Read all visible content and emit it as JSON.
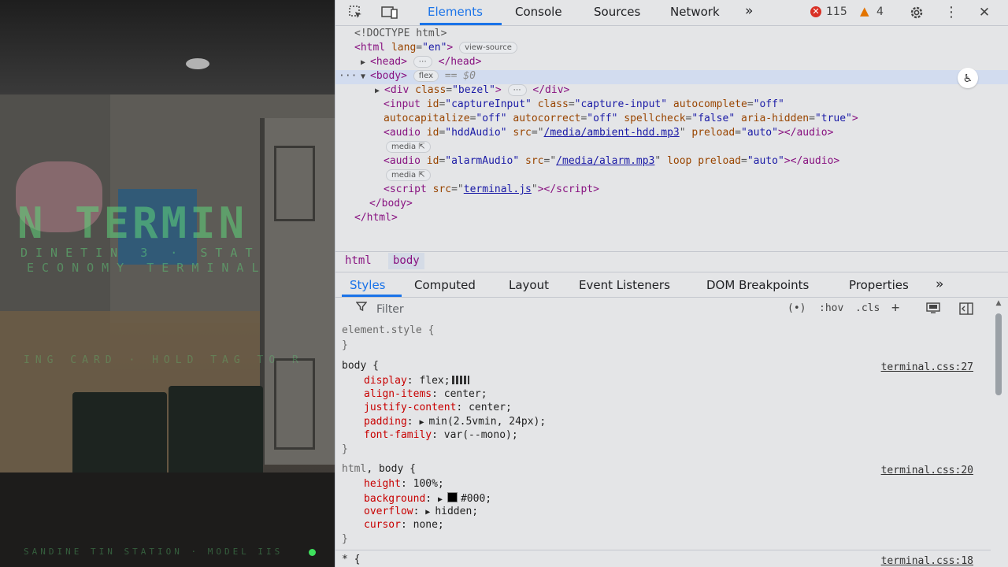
{
  "viewport": {
    "title": "N TERMIN",
    "subtitle1": "DINETIN 3 · STAT",
    "subtitle2": "ECONOMY TERMINAL",
    "hint": "ING CARD · HOLD TAG TO R",
    "footer": "SANDINE TIN STATION · MODEL IIS",
    "accent": "#5fd67b"
  },
  "devtools": {
    "toolbar": {
      "inspect_icon": "inspect-icon",
      "device_icon": "device-toolbar-icon",
      "tabs": [
        "Elements",
        "Console",
        "Sources",
        "Network"
      ],
      "more_tabs": "»",
      "errors": "115",
      "warnings": "4",
      "settings_icon": "gear-icon",
      "menu_icon": "kebab-icon",
      "close": "✕"
    },
    "dom": {
      "doctype": "<!DOCTYPE html>",
      "html_open": "<html",
      "html_attr": "lang",
      "html_val": "\"en\"",
      "view_source": "view-source",
      "head_open": "<head>",
      "ellipsis": "⋯",
      "head_close": "</head>",
      "row_dots": "···",
      "body_open": "<body>",
      "flex_chip": "flex",
      "eq_ref": "== $0",
      "div_open": "<div",
      "div_attr": "class",
      "div_val": "\"bezel\"",
      "div_close": "</div>",
      "input_open": "<input",
      "input_attrs1": [
        [
          "id",
          "\"captureInput\""
        ],
        [
          "class",
          "\"capture-input\""
        ],
        [
          "autocomplete",
          "\"off\""
        ]
      ],
      "input_attrs2": [
        [
          "autocapitalize",
          "\"off\""
        ],
        [
          "autocorrect",
          "\"off\""
        ],
        [
          "spellcheck",
          "\"false\""
        ],
        [
          "aria-hidden",
          "\"true\""
        ]
      ],
      "audio1_id": "\"hddAudio\"",
      "audio1_src": "/media/ambient-hdd.mp3",
      "audio1_rest": "preload",
      "audio1_rest_val": "\"auto\"",
      "audio2_id": "\"alarmAudio\"",
      "audio2_src": "/media/alarm.mp3",
      "audio2_loop": "loop",
      "audio2_rest": "preload",
      "audio2_rest_val": "\"auto\"",
      "media_chip": "media",
      "script_src": "terminal.js",
      "body_close": "</body>",
      "html_close": "</html>"
    },
    "breadcrumbs": [
      "html",
      "body"
    ],
    "style_tabs": [
      "Styles",
      "Computed",
      "Layout",
      "Event Listeners",
      "DOM Breakpoints",
      "Properties"
    ],
    "style_tabs_more": "»",
    "filter": {
      "placeholder": "Filter",
      "hov": ":hov",
      "cls": ".cls"
    },
    "styles": {
      "element_style": "element.style {",
      "close_brace": "}",
      "body_rule": {
        "selector": "body {",
        "source": "terminal.css:27",
        "props": [
          [
            "display",
            "flex;"
          ],
          [
            "align-items",
            "center;"
          ],
          [
            "justify-content",
            "center;"
          ],
          [
            "padding",
            "min(2.5vmin, 24px);"
          ],
          [
            "font-family",
            "var(--mono);"
          ]
        ]
      },
      "html_body_rule": {
        "selector_a": "html",
        "selector_b": ", body {",
        "source": "terminal.css:20",
        "props": [
          [
            "height",
            "100%;"
          ],
          [
            "background",
            "#000;"
          ],
          [
            "overflow",
            "hidden;"
          ],
          [
            "cursor",
            "none;"
          ]
        ]
      },
      "star_rule": {
        "selector": "* {",
        "source": "terminal.css:18"
      }
    },
    "colors": {
      "accent": "#1a73e8",
      "tag": "#881280",
      "attr": "#994500",
      "value": "#1a1aa6",
      "prop": "#c80000"
    }
  }
}
